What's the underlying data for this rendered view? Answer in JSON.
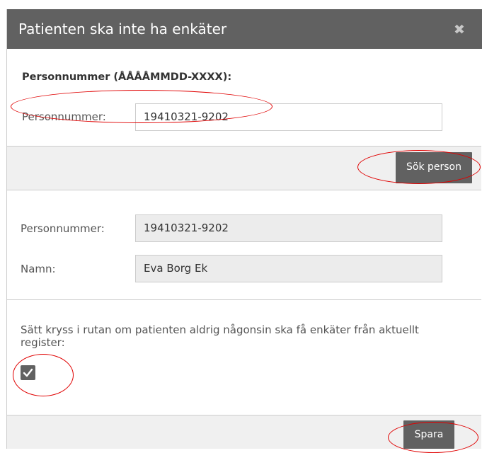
{
  "dialog": {
    "title": "Patienten ska inte ha enkäter",
    "close_icon": "close-icon"
  },
  "search": {
    "heading": "Personnummer (ÅÅÅÅMMDD-XXXX):",
    "label": "Personnummer:",
    "value": "19410321-9202",
    "button_label": "Sök person"
  },
  "result": {
    "personnummer_label": "Personnummer:",
    "personnummer_value": "19410321-9202",
    "namn_label": "Namn:",
    "namn_value": "Eva Borg Ek"
  },
  "optout": {
    "text": "Sätt kryss i rutan om patienten aldrig någonsin ska få enkäter från aktuellt register:",
    "checked": true,
    "check_icon": "checkmark-icon"
  },
  "footer": {
    "save_label": "Spara"
  },
  "colors": {
    "titlebar": "#616161",
    "button": "#616161",
    "annotation": "#e00000"
  }
}
